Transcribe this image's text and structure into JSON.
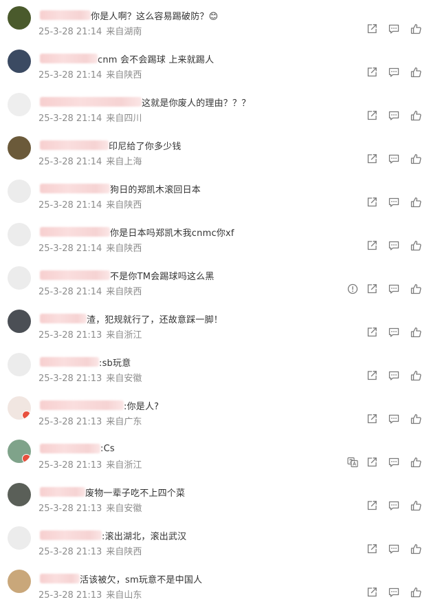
{
  "comments": [
    {
      "text": "你是人啊？这么容易踢破防？😊",
      "time": "25-3-28 21:14",
      "location": "来自湖南",
      "avatar_color": "#4a5a2c",
      "extra_icon": null
    },
    {
      "text": "cnm 会不会踢球 上来就踢人",
      "time": "25-3-28 21:14",
      "location": "来自陕西",
      "avatar_color": "#3b4a62",
      "extra_icon": null
    },
    {
      "text": "这就是你废人的理由？？？",
      "time": "25-3-28 21:14",
      "location": "来自四川",
      "avatar_color": "#eeeeee",
      "extra_icon": null
    },
    {
      "text": "印尼给了你多少钱",
      "time": "25-3-28 21:14",
      "location": "来自上海",
      "avatar_color": "#6b5a3a",
      "extra_icon": null
    },
    {
      "text": "狗日的郑凯木滚回日本",
      "time": "25-3-28 21:14",
      "location": "来自陕西",
      "avatar_color": "#ececec",
      "extra_icon": null
    },
    {
      "text": "你是日本吗郑凯木我cnmc你xf",
      "time": "25-3-28 21:14",
      "location": "来自陕西",
      "avatar_color": "#ececec",
      "extra_icon": null
    },
    {
      "text": "不是你TM会踢球吗这么黑",
      "time": "25-3-28 21:14",
      "location": "来自陕西",
      "avatar_color": "#ececec",
      "extra_icon": "report-icon"
    },
    {
      "text": "渣，犯规就行了，还故意踩一脚！",
      "time": "25-3-28 21:13",
      "location": "来自浙江",
      "avatar_color": "#4b4f55",
      "extra_icon": null
    },
    {
      "text": ":sb玩意",
      "time": "25-3-28 21:13",
      "location": "来自安徽",
      "avatar_color": "#ececec",
      "extra_icon": null
    },
    {
      "text": ":你是人?",
      "time": "25-3-28 21:13",
      "location": "来自广东",
      "avatar_color": "#f1e6e1",
      "extra_icon": null,
      "badge": true
    },
    {
      "text": ":Cs",
      "time": "25-3-28 21:13",
      "location": "来自浙江",
      "avatar_color": "#7fa38a",
      "extra_icon": "translate-icon",
      "badge": true
    },
    {
      "text": "废物一辈子吃不上四个菜",
      "time": "25-3-28 21:13",
      "location": "来自安徽",
      "avatar_color": "#5a5f58",
      "extra_icon": null
    },
    {
      "text": ":滚出湖北，滚出武汉",
      "time": "25-3-28 21:13",
      "location": "来自陕西",
      "avatar_color": "#ececec",
      "extra_icon": null
    },
    {
      "text": "活该被欠，sm玩意不是中国人",
      "time": "25-3-28 21:13",
      "location": "来自山东",
      "avatar_color": "#c9a77a",
      "extra_icon": null
    }
  ],
  "icons": {
    "share": "share-icon",
    "reply": "comment-icon",
    "like": "thumbs-up-icon"
  },
  "colors": {
    "text": "#333333",
    "meta": "#8c8c8c",
    "icon": "#7a7a7a"
  }
}
